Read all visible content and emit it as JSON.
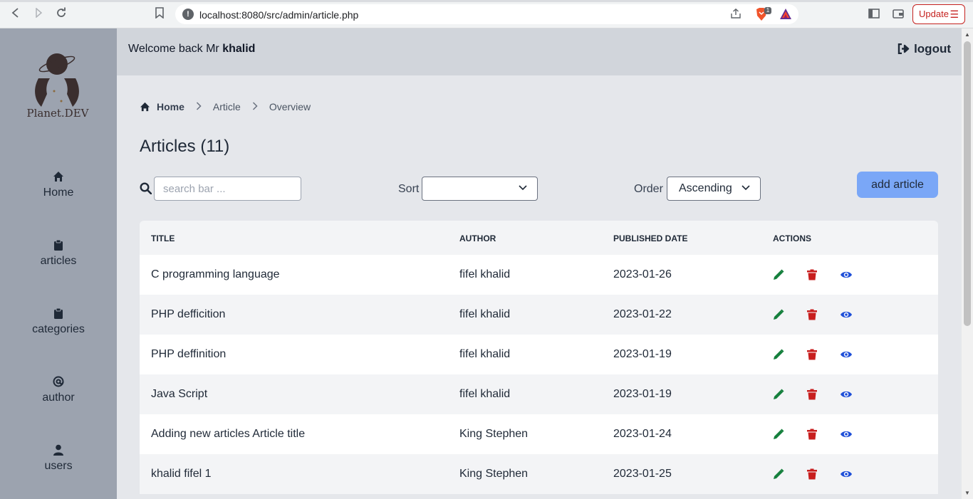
{
  "browser": {
    "url": "localhost:8080/src/admin/article.php",
    "update_label": "Update",
    "brave_badge": "1"
  },
  "sidebar": {
    "logo_text": "Planet.DEV",
    "items": [
      {
        "label": "Home",
        "icon": "home-icon"
      },
      {
        "label": "articles",
        "icon": "clipboard-icon"
      },
      {
        "label": "categories",
        "icon": "clipboard-icon"
      },
      {
        "label": "author",
        "icon": "at-icon"
      },
      {
        "label": "users",
        "icon": "user-icon"
      }
    ]
  },
  "header": {
    "welcome_prefix": "Welcome back Mr",
    "username": "khalid",
    "logout_label": "logout"
  },
  "breadcrumb": [
    "Home",
    "Article",
    "Overview"
  ],
  "page": {
    "title": "Articles (11)",
    "search_placeholder": "search bar ...",
    "sort_label": "Sort",
    "sort_value": "",
    "order_label": "Order",
    "order_value": "Ascending",
    "add_button": "add article"
  },
  "table": {
    "headers": [
      "TITLE",
      "AUTHOR",
      "PUBLISHED DATE",
      "ACTIONS"
    ],
    "rows": [
      {
        "title": "C programming language",
        "author": "fifel khalid",
        "date": "2023-01-26"
      },
      {
        "title": "PHP defficition",
        "author": "fifel khalid",
        "date": "2023-01-22"
      },
      {
        "title": "PHP deffinition",
        "author": "fifel khalid",
        "date": "2023-01-19"
      },
      {
        "title": "Java Script",
        "author": "fifel khalid",
        "date": "2023-01-19"
      },
      {
        "title": "Adding new articles Article title",
        "author": "King Stephen",
        "date": "2023-01-24"
      },
      {
        "title": "khalid fifel 1",
        "author": "King Stephen",
        "date": "2023-01-25"
      }
    ]
  },
  "colors": {
    "edit": "#15803d",
    "delete": "#c81e1e",
    "view": "#1d4ed8",
    "accent_button": "#7aa7f7"
  }
}
